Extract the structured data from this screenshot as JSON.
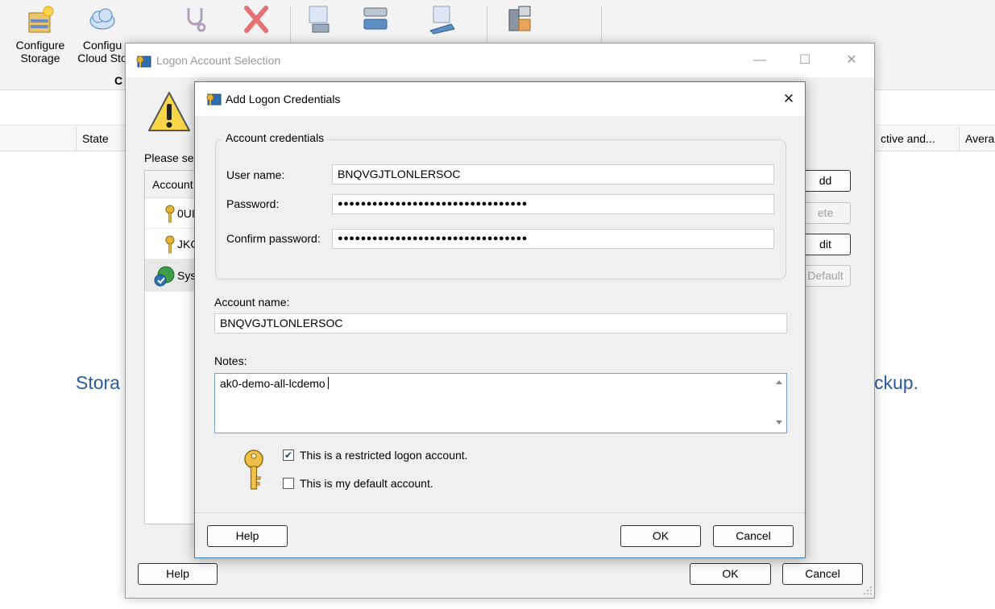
{
  "ribbon": {
    "buttons": [
      {
        "label1": "Configure",
        "label2": "Storage",
        "icon": "configure-storage-icon"
      },
      {
        "label1": "Configu",
        "label2": "Cloud Sto",
        "icon": "configure-cloud-storage-icon"
      },
      {
        "label1": "",
        "label2": "",
        "icon": "troubleshoot-icon"
      },
      {
        "label1": "",
        "label2": "",
        "icon": "delete-icon"
      },
      {
        "label1": "",
        "label2": "",
        "icon": "inventory-icon"
      },
      {
        "label1": "",
        "label2": "",
        "icon": "catalog-icon"
      },
      {
        "label1": "",
        "label2": "",
        "icon": "import-icon"
      },
      {
        "label1": "",
        "label2": "",
        "icon": "properties-icon"
      }
    ],
    "group_label": "C"
  },
  "columns": {
    "state": "State",
    "active": "ctive and...",
    "avg": "Avera"
  },
  "background_text": {
    "left": "Stora",
    "right": "ckup."
  },
  "logon_dialog": {
    "title": "Logon Account Selection",
    "prompt": "Please se",
    "list_header": "Account",
    "accounts": [
      "0UI",
      "JKC",
      "Sys"
    ],
    "buttons": {
      "add": "dd",
      "delete": "ete",
      "edit": "dit",
      "default": "Default",
      "help": "Help",
      "ok": "OK",
      "cancel": "Cancel"
    },
    "controls": {
      "minimize": "—",
      "maximize": "☐",
      "close": "✕"
    }
  },
  "add_dialog": {
    "title": "Add Logon Credentials",
    "close": "✕",
    "group_title": "Account credentials",
    "user_name_label": "User name:",
    "user_name": "BNQVGJTLONLERSOC",
    "password_label": "Password:",
    "password": "●●●●●●●●●●●●●●●●●●●●●●●●●●●●●●●●●",
    "confirm_label": "Confirm password:",
    "confirm": "●●●●●●●●●●●●●●●●●●●●●●●●●●●●●●●●●",
    "account_name_label": "Account name:",
    "account_name": "BNQVGJTLONLERSOC",
    "notes_label": "Notes:",
    "notes": "ak0-demo-all-lcdemo",
    "restricted_label": "This is a restricted logon account.",
    "restricted_checked": true,
    "default_label": "This is my default account.",
    "default_checked": false,
    "help": "Help",
    "ok": "OK",
    "cancel": "Cancel",
    "checkmark": "✔"
  },
  "colors": {
    "accent": "#3c7fb1",
    "link_text": "#2a5aa3"
  }
}
